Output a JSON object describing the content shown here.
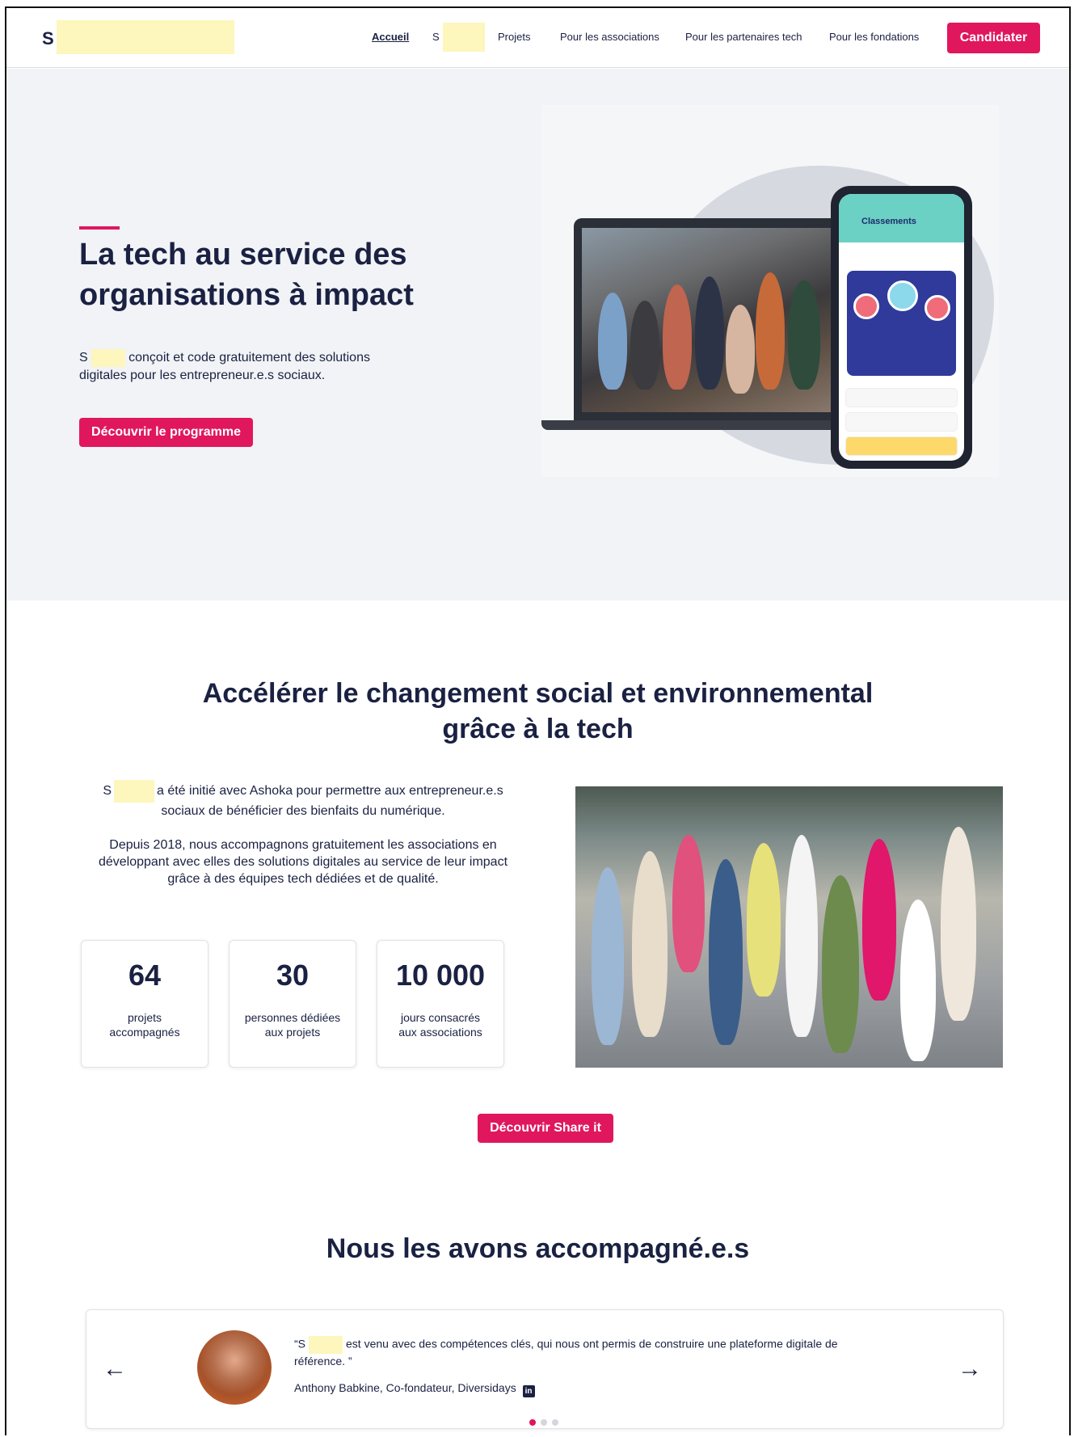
{
  "nav": {
    "logo": "S",
    "links": [
      {
        "label": "Accueil",
        "active": true
      },
      {
        "label": "S",
        "active": false
      },
      {
        "label": "Projets",
        "active": false
      },
      {
        "label": "Pour les associations",
        "active": false
      },
      {
        "label": "Pour les partenaires tech",
        "active": false
      },
      {
        "label": "Pour les fondations",
        "active": false
      }
    ],
    "cta": "Candidater"
  },
  "hero": {
    "title": "La tech au service des organisations à impact",
    "desc_prefix": "S",
    "desc_rest": "conçoit et code gratuitement des solutions digitales pour les entrepreneur.e.s sociaux.",
    "cta": "Découvrir le programme",
    "phone": {
      "title": "Classements"
    }
  },
  "mission": {
    "title": "Accélérer le changement social et environnemental grâce à la tech",
    "p1_prefix": "S",
    "p1_rest": "a été initié avec Ashoka pour permettre aux entrepreneur.e.s sociaux de bénéficier des bienfaits du numérique.",
    "p2": "Depuis 2018, nous accompagnons gratuitement les associations en développant avec elles des solutions digitales au service de leur impact grâce à des équipes tech dédiées et de qualité.",
    "stats": [
      {
        "value": "64",
        "label": "projets accompagnés"
      },
      {
        "value": "30",
        "label": "personnes dédiées aux projets"
      },
      {
        "value": "10 000",
        "label": "jours consacrés aux associations"
      }
    ],
    "cta": "Découvrir Share it"
  },
  "testimonials": {
    "title": "Nous les avons accompagné.e.s",
    "quote_open": "“S",
    "quote_rest": "est venu avec des compétences clés, qui nous ont permis de construire une plateforme digitale de référence. ”",
    "author": "Anthony Babkine, Co-fondateur, Diversidays",
    "prev": "←",
    "next": "→",
    "linkedin": "in",
    "active_slide": 1,
    "slide_count": 3
  },
  "colors": {
    "accent": "#e0175d",
    "text": "#1a2142",
    "hero_bg": "#f1f3f6"
  },
  "icons": [
    "arrow-left-icon",
    "arrow-right-icon",
    "linkedin-icon"
  ]
}
